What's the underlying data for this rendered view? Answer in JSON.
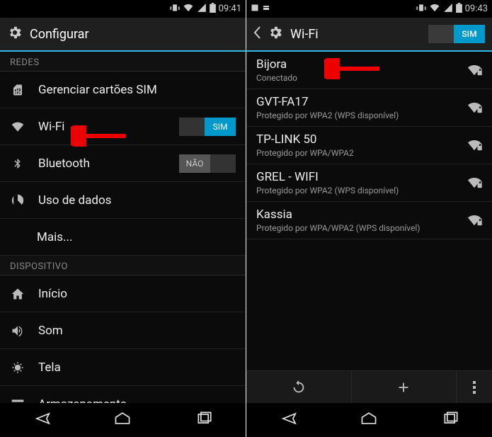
{
  "left": {
    "statusbar": {
      "time": "09:41"
    },
    "actionbar": {
      "title": "Configurar"
    },
    "sections": {
      "redes": "REDES",
      "dispositivo": "DISPOSITIVO"
    },
    "rows": {
      "sim": "Gerenciar cartões SIM",
      "wifi": "Wi-Fi",
      "wifi_toggle": "SIM",
      "bluetooth": "Bluetooth",
      "bluetooth_toggle": "NÃO",
      "data": "Uso de dados",
      "more": "Mais...",
      "home": "Início",
      "sound": "Som",
      "display": "Tela",
      "storage": "Armazenamento"
    }
  },
  "right": {
    "statusbar": {
      "time": "09:43"
    },
    "actionbar": {
      "title": "Wi-Fi",
      "toggle": "SIM"
    },
    "networks": [
      {
        "ssid": "Bijora",
        "status": "Conectado"
      },
      {
        "ssid": "GVT-FA17",
        "status": "Protegido por WPA2 (WPS disponível)"
      },
      {
        "ssid": "TP-LINK 50",
        "status": "Protegido por WPA/WPA2"
      },
      {
        "ssid": "GREL - WIFI",
        "status": "Protegido por WPA2 (WPS disponível)"
      },
      {
        "ssid": "Kassia",
        "status": "Protegido por WPA/WPA2 (WPS disponível)"
      }
    ]
  }
}
